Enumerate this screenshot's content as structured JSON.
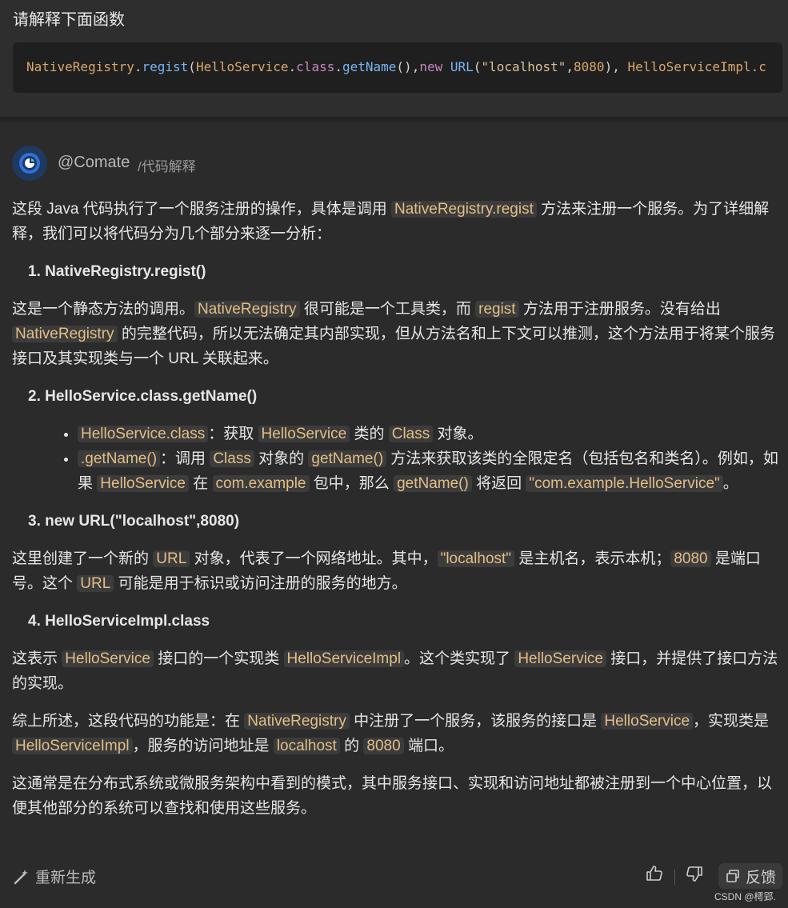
{
  "prompt": "请解释下面函数",
  "code": {
    "p1": "NativeRegistry",
    "p2": ".",
    "p3": "regist",
    "p4": "(",
    "p5": "HelloService",
    "p6": ".",
    "p7": "class",
    "p8": ".",
    "p9": "getName",
    "p10": "(),",
    "p11": "new",
    "p12": " ",
    "p13": "URL",
    "p14": "(",
    "p15": "\"localhost\"",
    "p16": ",",
    "p17": "8080",
    "p18": "), ",
    "p19": "HelloServiceImpl",
    "p20": ".c"
  },
  "author": "@Comate",
  "command": "/代码解释",
  "intro": {
    "t1": "这段 Java 代码执行了一个服务注册的操作，具体是调用 ",
    "c1": "NativeRegistry.regist",
    "t2": " 方法来注册一个服务。为了详细解释，我们可以将代码分为几个部分来逐一分析："
  },
  "h1": "1. NativeRegistry.regist()",
  "p1": {
    "t1": "这是一个静态方法的调用。",
    "c1": "NativeRegistry",
    "t2": " 很可能是一个工具类，而 ",
    "c2": "regist",
    "t3": " 方法用于注册服务。没有给出 ",
    "c3": "NativeRegistry",
    "t4": " 的完整代码，所以无法确定其内部实现，但从方法名和上下文可以推测，这个方法用于将某个服务接口及其实现类与一个 URL 关联起来。"
  },
  "h2": "2. HelloService.class.getName()",
  "b1": {
    "c1": "HelloService.class",
    "t1": "：获取 ",
    "c2": "HelloService",
    "t2": " 类的 ",
    "c3": "Class",
    "t3": " 对象。"
  },
  "b2": {
    "c1": ".getName()",
    "t1": "：调用 ",
    "c2": "Class",
    "t2": " 对象的 ",
    "c3": "getName()",
    "t3": " 方法来获取该类的全限定名（包括包名和类名）。例如，如果 ",
    "c4": "HelloService",
    "t4": " 在 ",
    "c5": "com.example",
    "t5": " 包中，那么 ",
    "c6": "getName()",
    "t6": " 将返回 ",
    "c7": "\"com.example.HelloService\"",
    "t7": "。"
  },
  "h3": "3. new URL(\"localhost\",8080)",
  "p3": {
    "t1": "这里创建了一个新的 ",
    "c1": "URL",
    "t2": " 对象，代表了一个网络地址。其中，",
    "c2": "\"localhost\"",
    "t3": " 是主机名，表示本机；",
    "c3": "8080",
    "t4": " 是端口号。这个 ",
    "c4": "URL",
    "t5": " 可能是用于标识或访问注册的服务的地方。"
  },
  "h4": "4. HelloServiceImpl.class",
  "p4": {
    "t1": "这表示 ",
    "c1": "HelloService",
    "t2": " 接口的一个实现类 ",
    "c2": "HelloServiceImpl",
    "t3": "。这个类实现了 ",
    "c3": "HelloService",
    "t4": " 接口，并提供了接口方法的实现。"
  },
  "p5": {
    "t1": "综上所述，这段代码的功能是：在 ",
    "c1": "NativeRegistry",
    "t2": " 中注册了一个服务，该服务的接口是 ",
    "c2": "HelloService",
    "t3": "，实现类是 ",
    "c3": "HelloServiceImpl",
    "t4": "，服务的访问地址是 ",
    "c4": "localhost",
    "t5": " 的 ",
    "c5": "8080",
    "t6": " 端口。"
  },
  "p6": "这通常是在分布式系统或微服务架构中看到的模式，其中服务接口、实现和访问地址都被注册到一个中心位置，以便其他部分的系统可以查找和使用这些服务。",
  "footer": {
    "regenerate": "重新生成",
    "feedback": "反馈"
  },
  "watermark": "CSDN @樗郢."
}
